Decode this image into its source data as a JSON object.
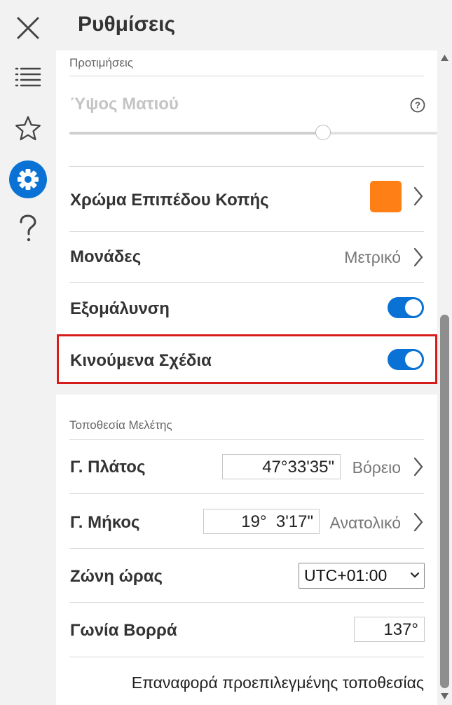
{
  "header": {
    "title": "Ρυθμίσεις"
  },
  "rail": {
    "items": [
      {
        "icon": "close-icon"
      },
      {
        "icon": "list-icon"
      },
      {
        "icon": "star-icon"
      },
      {
        "icon": "gear-icon",
        "active": true
      },
      {
        "icon": "help-icon"
      }
    ],
    "accent": "#0a72d4"
  },
  "preferences": {
    "section_title": "Προτιμήσεις",
    "eye_height": {
      "label": "Ύψος Ματιού",
      "help_glyph": "?",
      "slider_value": 0.69,
      "disabled": true
    },
    "cut_plane_color": {
      "label": "Χρώμα Επιπέδου Κοπής",
      "color": "#ff7f17"
    },
    "units": {
      "label": "Μονάδες",
      "value": "Μετρικό"
    },
    "smoothing": {
      "label": "Εξομάλυνση",
      "on": true
    },
    "animated_drawings": {
      "label": "Κινούμενα Σχέδια",
      "on": true
    }
  },
  "study_location": {
    "section_title": "Τοποθεσία Μελέτης",
    "latitude": {
      "label": "Γ. Πλάτος",
      "value": "47°33'35\"",
      "hemisphere": "Βόρειο"
    },
    "longitude": {
      "label": "Γ. Μήκος",
      "value": "19°  3'17\"",
      "hemisphere": "Ανατολικό"
    },
    "time_zone": {
      "label": "Ζώνη ώρας",
      "value": "UTC+01:00"
    },
    "north_angle": {
      "label": "Γωνία Βορρά",
      "value": "137°"
    },
    "reset_label": "Επαναφορά προεπιλεγμένης τοποθεσίας"
  },
  "colors": {
    "highlight": "#d81c1c",
    "toggle_on": "#0a72d4"
  }
}
